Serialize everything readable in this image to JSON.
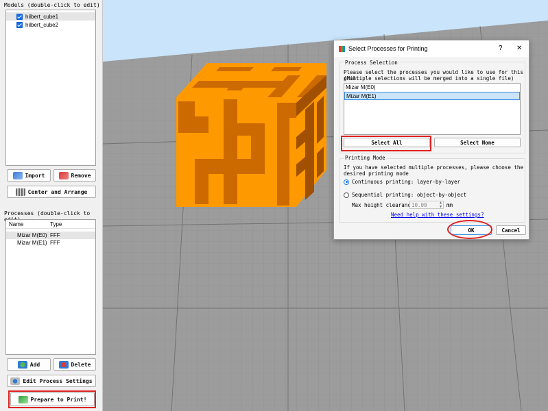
{
  "models": {
    "title": "Models (double-click to edit)",
    "items": [
      {
        "label": "hilbert_cube1",
        "checked": true,
        "selected": true
      },
      {
        "label": "hilbert_cube2",
        "checked": true,
        "selected": false
      }
    ],
    "import_label": "Import",
    "remove_label": "Remove",
    "center_label": "Center and Arrange"
  },
  "processes": {
    "title": "Processes (double-click to edit)",
    "columns": [
      "Name",
      "Type"
    ],
    "rows": [
      {
        "name": "Mizar M(E0)",
        "type": "FFF",
        "selected": true
      },
      {
        "name": "Mizar M(E1)",
        "type": "FFF",
        "selected": false
      }
    ],
    "add_label": "Add",
    "delete_label": "Delete",
    "edit_label": "Edit Process Settings",
    "prepare_label": "Prepare to Print!"
  },
  "dialog": {
    "title": "Select Processes for Printing",
    "help_glyph": "?",
    "close_glyph": "✕",
    "process_selection_title": "Process Selection",
    "process_instructions_1": "Please select the processes you would like to use for this print.",
    "process_instructions_2": "(Multiple selections will be merged into a single file)",
    "process_list": [
      "Mizar M(E0)",
      "Mizar M(E1)"
    ],
    "select_all_label": "Select All",
    "select_none_label": "Select None",
    "printing_mode_title": "Printing Mode",
    "mode_info_1": "If you have selected multiple processes, please choose the",
    "mode_info_2": "desired printing mode",
    "continuous_label": "Continuous printing: layer-by-layer",
    "sequential_label": "Sequential printing: object-by-object",
    "max_height_label": "Max height clearance",
    "max_height_value": "10.00",
    "max_height_unit": "mm",
    "help_link": "Need help with these settings?",
    "ok_label": "OK",
    "cancel_label": "Cancel",
    "selected_mode": "continuous"
  },
  "colors": {
    "cube_light": "#ff9900",
    "cube_dark": "#cc6a00",
    "sky": "#c9e4fb",
    "grid_floor": "#9c9c9c",
    "highlight_red": "#e02020",
    "link_blue": "#0000ee"
  }
}
